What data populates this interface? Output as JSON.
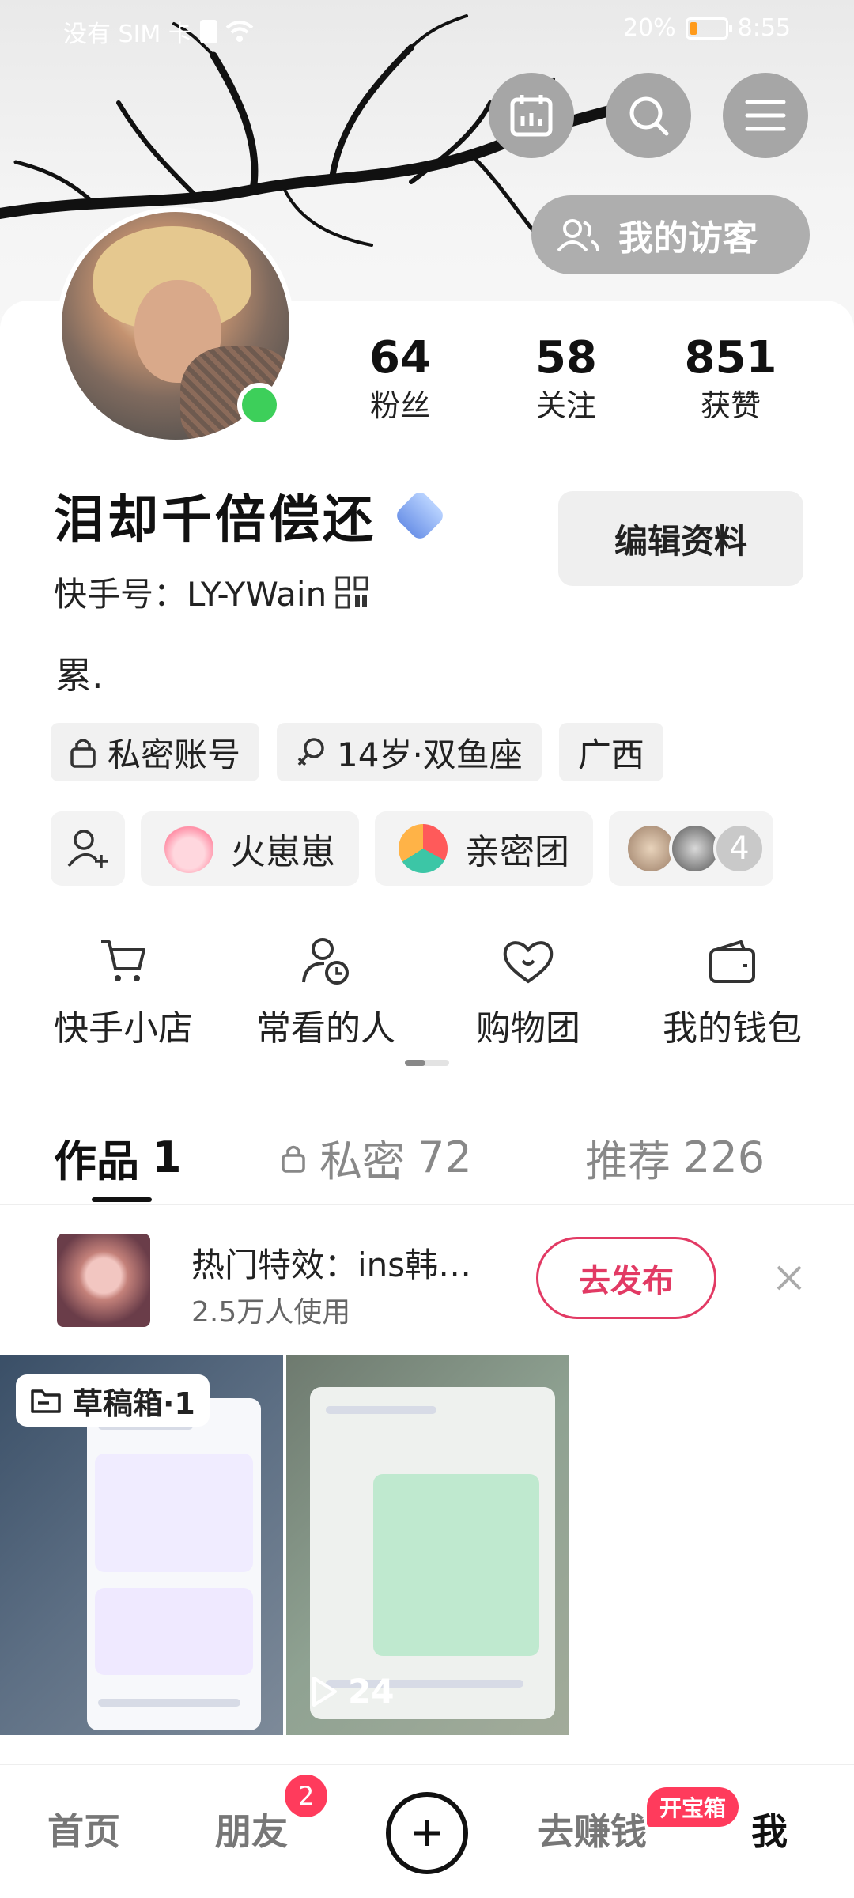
{
  "status_bar": {
    "carrier": "没有 SIM 卡",
    "battery": "20%",
    "battery_level": 0.2,
    "time": "8:55"
  },
  "header": {
    "visitors_label": "我的访客"
  },
  "stats": [
    {
      "value": "64",
      "label": "粉丝"
    },
    {
      "value": "58",
      "label": "关注"
    },
    {
      "value": "851",
      "label": "获赞"
    }
  ],
  "profile": {
    "name": "泪却千倍偿还",
    "kuaishou_id": "快手号：LY-YWain",
    "bio": "累.",
    "edit_label": "编辑资料",
    "tags": [
      "私密账号",
      "14岁·双鱼座",
      "广西"
    ]
  },
  "pills": {
    "fire_label": "火崽崽",
    "group_label": "亲密团",
    "friends_more": "4"
  },
  "shortcuts": [
    "快手小店",
    "常看的人",
    "购物团",
    "我的钱包"
  ],
  "tabs": [
    {
      "label": "作品",
      "count": "1"
    },
    {
      "label": "私密",
      "count": "72"
    },
    {
      "label": "推荐",
      "count": "226"
    }
  ],
  "promo": {
    "title": "热门特效：ins韩…",
    "subtitle": "2.5万人使用",
    "button": "去发布"
  },
  "grid": {
    "draft_label": "草稿箱·1",
    "play_count": "24"
  },
  "bottom_nav": {
    "home": "首页",
    "friends": "朋友",
    "friends_badge": "2",
    "earn": "去赚钱",
    "earn_tag": "开宝箱",
    "me": "我"
  }
}
